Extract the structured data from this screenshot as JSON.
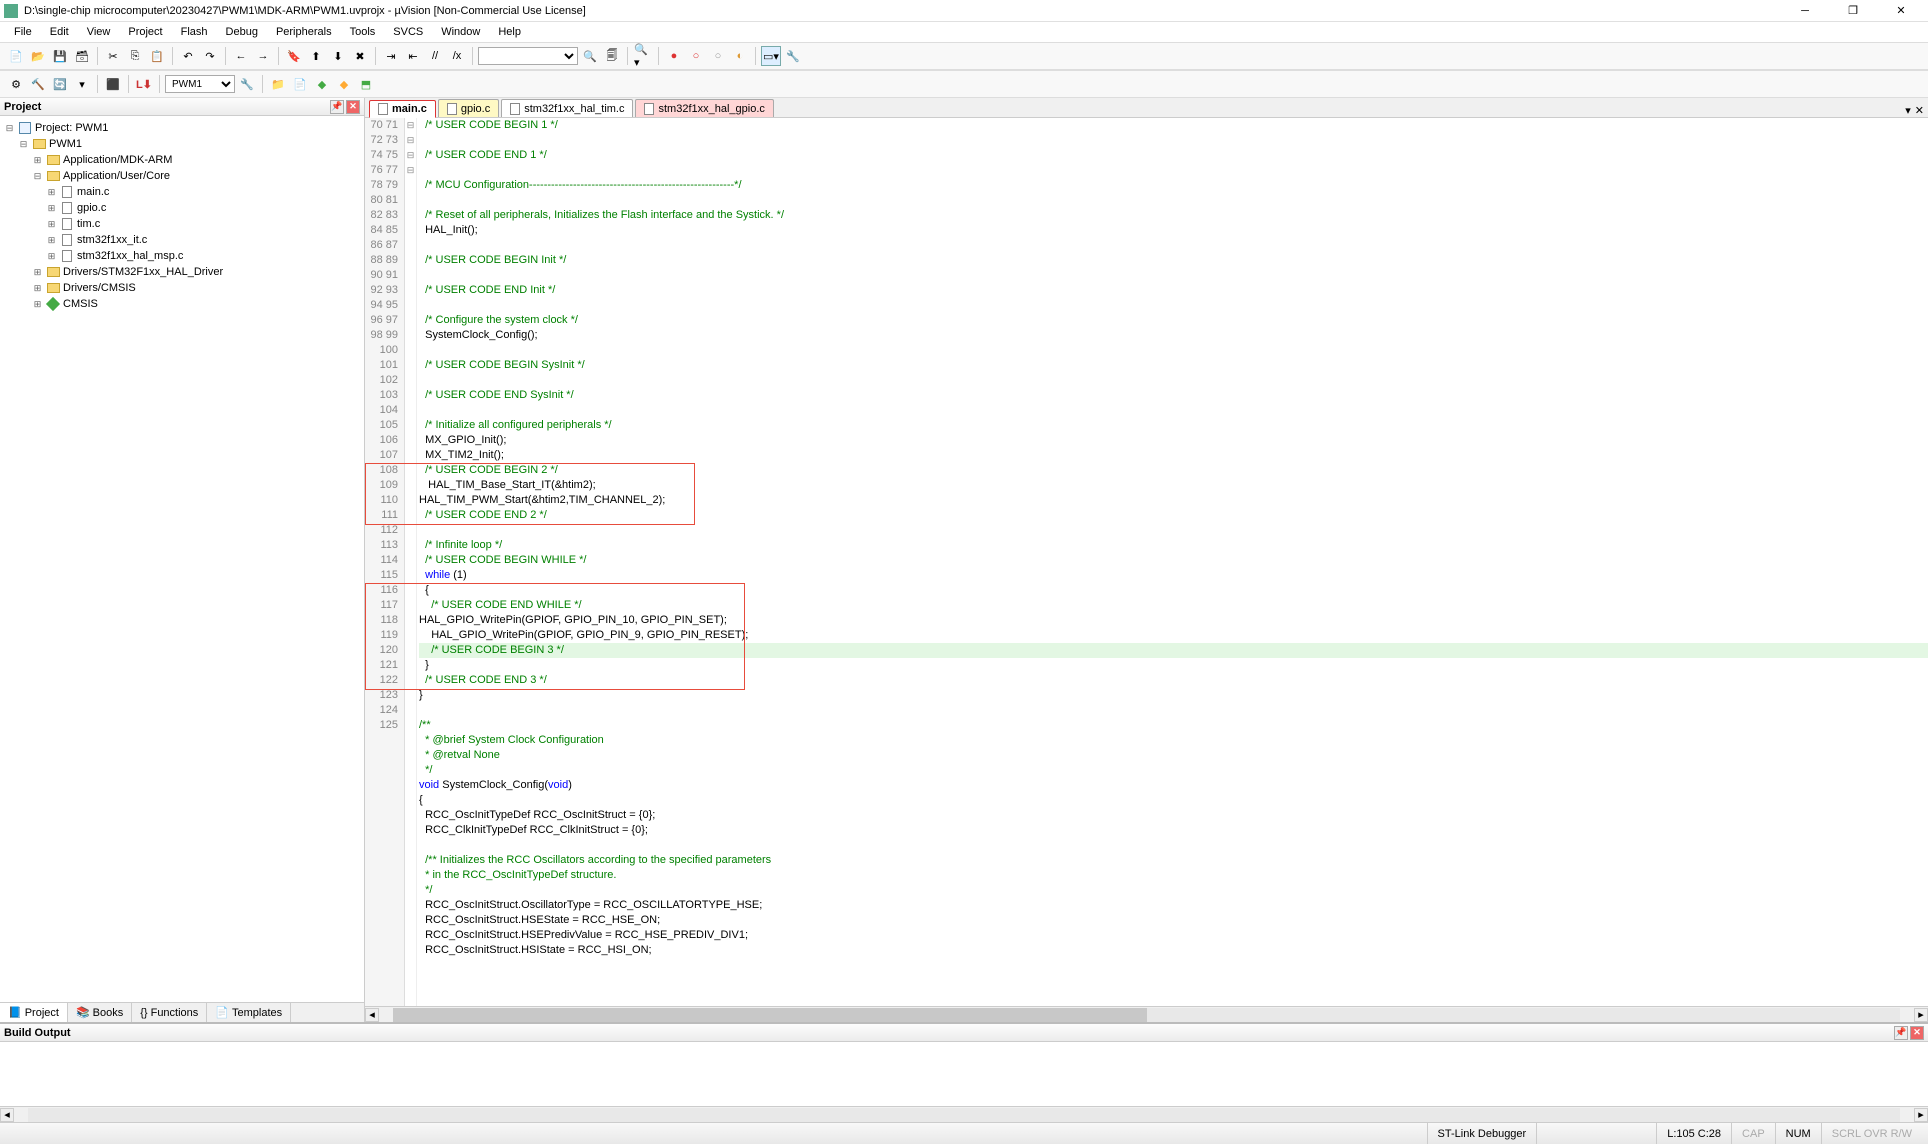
{
  "window": {
    "title": "D:\\single-chip microcomputer\\20230427\\PWM1\\MDK-ARM\\PWM1.uvprojx - µVision   [Non-Commercial Use License]"
  },
  "menu": [
    "File",
    "Edit",
    "View",
    "Project",
    "Flash",
    "Debug",
    "Peripherals",
    "Tools",
    "SVCS",
    "Window",
    "Help"
  ],
  "target_combo": "PWM1",
  "project_panel": {
    "title": "Project",
    "tree": {
      "root": "Project: PWM1",
      "target": "PWM1",
      "groups": [
        {
          "name": "Application/MDK-ARM",
          "expanded": false
        },
        {
          "name": "Application/User/Core",
          "expanded": true,
          "files": [
            "main.c",
            "gpio.c",
            "tim.c",
            "stm32f1xx_it.c",
            "stm32f1xx_hal_msp.c"
          ]
        },
        {
          "name": "Drivers/STM32F1xx_HAL_Driver",
          "expanded": false
        },
        {
          "name": "Drivers/CMSIS",
          "expanded": false
        },
        {
          "name": "CMSIS",
          "expanded": false,
          "diamond": true
        }
      ]
    },
    "tabs": [
      "Project",
      "Books",
      "Functions",
      "Templates"
    ]
  },
  "file_tabs": [
    {
      "label": "main.c",
      "style": "active"
    },
    {
      "label": "gpio.c",
      "style": "yellow"
    },
    {
      "label": "stm32f1xx_hal_tim.c",
      "style": "white"
    },
    {
      "label": "stm32f1xx_hal_gpio.c",
      "style": "red"
    }
  ],
  "code_start_line": 70,
  "code_lines": [
    {
      "t": "  /* USER CODE BEGIN 1 */",
      "c": "comment"
    },
    {
      "t": "",
      "c": "text"
    },
    {
      "t": "  /* USER CODE END 1 */",
      "c": "comment"
    },
    {
      "t": "",
      "c": "text"
    },
    {
      "t": "  /* MCU Configuration--------------------------------------------------------*/",
      "c": "comment"
    },
    {
      "t": "",
      "c": "text"
    },
    {
      "t": "  /* Reset of all peripherals, Initializes the Flash interface and the Systick. */",
      "c": "comment"
    },
    {
      "t": "  HAL_Init();",
      "c": "text"
    },
    {
      "t": "",
      "c": "text"
    },
    {
      "t": "  /* USER CODE BEGIN Init */",
      "c": "comment"
    },
    {
      "t": "",
      "c": "text"
    },
    {
      "t": "  /* USER CODE END Init */",
      "c": "comment"
    },
    {
      "t": "",
      "c": "text"
    },
    {
      "t": "  /* Configure the system clock */",
      "c": "comment"
    },
    {
      "t": "  SystemClock_Config();",
      "c": "text"
    },
    {
      "t": "",
      "c": "text"
    },
    {
      "t": "  /* USER CODE BEGIN SysInit */",
      "c": "comment"
    },
    {
      "t": "",
      "c": "text"
    },
    {
      "t": "  /* USER CODE END SysInit */",
      "c": "comment"
    },
    {
      "t": "",
      "c": "text"
    },
    {
      "t": "  /* Initialize all configured peripherals */",
      "c": "comment"
    },
    {
      "t": "  MX_GPIO_Init();",
      "c": "text"
    },
    {
      "t": "  MX_TIM2_Init();",
      "c": "text"
    },
    {
      "t": "  /* USER CODE BEGIN 2 */",
      "c": "comment"
    },
    {
      "t": "   HAL_TIM_Base_Start_IT(&htim2);",
      "c": "text"
    },
    {
      "t": "HAL_TIM_PWM_Start(&htim2,TIM_CHANNEL_2);",
      "c": "text"
    },
    {
      "t": "  /* USER CODE END 2 */",
      "c": "comment"
    },
    {
      "t": "",
      "c": "text"
    },
    {
      "t": "  /* Infinite loop */",
      "c": "comment"
    },
    {
      "t": "  /* USER CODE BEGIN WHILE */",
      "c": "comment"
    },
    {
      "t": "  while (1)",
      "c": "kw-line"
    },
    {
      "t": "  {",
      "c": "text",
      "fold": "open"
    },
    {
      "t": "    /* USER CODE END WHILE */",
      "c": "comment"
    },
    {
      "t": "HAL_GPIO_WritePin(GPIOF, GPIO_PIN_10, GPIO_PIN_SET);",
      "c": "text"
    },
    {
      "t": "    HAL_GPIO_WritePin(GPIOF, GPIO_PIN_9, GPIO_PIN_RESET);",
      "c": "text"
    },
    {
      "t": "    /* USER CODE BEGIN 3 */",
      "c": "comment",
      "hl": true
    },
    {
      "t": "  }",
      "c": "text"
    },
    {
      "t": "  /* USER CODE END 3 */",
      "c": "comment"
    },
    {
      "t": "}",
      "c": "text"
    },
    {
      "t": "",
      "c": "text"
    },
    {
      "t": "/**",
      "c": "comment",
      "fold": "open"
    },
    {
      "t": "  * @brief System Clock Configuration",
      "c": "comment"
    },
    {
      "t": "  * @retval None",
      "c": "comment"
    },
    {
      "t": "  */",
      "c": "comment"
    },
    {
      "t": "void SystemClock_Config(void)",
      "c": "kw-line2"
    },
    {
      "t": "{",
      "c": "text",
      "fold": "open"
    },
    {
      "t": "  RCC_OscInitTypeDef RCC_OscInitStruct = {0};",
      "c": "struct"
    },
    {
      "t": "  RCC_ClkInitTypeDef RCC_ClkInitStruct = {0};",
      "c": "struct"
    },
    {
      "t": "",
      "c": "text"
    },
    {
      "t": "  /** Initializes the RCC Oscillators according to the specified parameters",
      "c": "comment",
      "fold": "open"
    },
    {
      "t": "  * in the RCC_OscInitTypeDef structure.",
      "c": "comment"
    },
    {
      "t": "  */",
      "c": "comment"
    },
    {
      "t": "  RCC_OscInitStruct.OscillatorType = RCC_OSCILLATORTYPE_HSE;",
      "c": "text"
    },
    {
      "t": "  RCC_OscInitStruct.HSEState = RCC_HSE_ON;",
      "c": "text"
    },
    {
      "t": "  RCC_OscInitStruct.HSEPredivValue = RCC_HSE_PREDIV_DIV1;",
      "c": "text"
    },
    {
      "t": "  RCC_OscInitStruct.HSIState = RCC_HSI_ON;",
      "c": "text"
    }
  ],
  "build_output": {
    "title": "Build Output"
  },
  "status": {
    "debugger": "ST-Link Debugger",
    "cursor": "L:105 C:28",
    "caps": "CAP",
    "num": "NUM",
    "rest": "SCRL OVR R/W"
  }
}
